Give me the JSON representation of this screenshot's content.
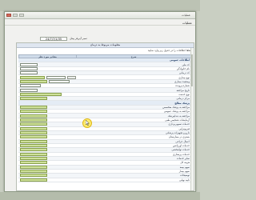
{
  "window": {
    "title": "عملیات",
    "menu": "عملیات"
  },
  "search": {
    "label": "نمبر آپریٹر پینل",
    "date": "24/7/7/1/35"
  },
  "content": {
    "header": "معلومات مربوط به درمان",
    "info_line": "لطفا اطلاعات را در جدول زیر وارد نمایید",
    "col_value": "مقادیر مورد نظر",
    "col_desc": "شرح"
  },
  "rows": [
    {
      "desc": "اطلاعات عمومی",
      "section": true,
      "boxes": []
    },
    {
      "desc": "کد ملی",
      "boxes": [
        {
          "t": "",
          "c": "num"
        }
      ]
    },
    {
      "desc": "نام خانوادگی",
      "boxes": [
        {
          "t": "",
          "c": "num"
        }
      ]
    },
    {
      "desc": "کد درمانی",
      "boxes": [
        {
          "t": "",
          "c": "num"
        }
      ]
    },
    {
      "desc": "نوع بیماری",
      "boxes": [
        {
          "t": "",
          "c": "green"
        },
        {
          "t": "",
          "c": "plain"
        },
        {
          "t": "",
          "c": "btn"
        }
      ]
    },
    {
      "desc": "وضعیت بیماری",
      "boxes": [
        {
          "t": "",
          "c": "green"
        },
        {
          "t": "",
          "c": "plain"
        }
      ]
    },
    {
      "desc": "شماره پرونده",
      "boxes": [
        {
          "t": "",
          "c": "plain"
        }
      ]
    },
    {
      "desc": "تاریخ مراجعه",
      "boxes": [
        {
          "t": "",
          "c": "num"
        }
      ]
    },
    {
      "desc": "نوع خدمت",
      "boxes": [
        {
          "t": "",
          "c": "long"
        }
      ]
    },
    {
      "desc": "مرکز درمانی",
      "boxes": [
        {
          "t": "",
          "c": "green"
        }
      ]
    },
    {
      "desc": "پزشک معالج",
      "section": true,
      "boxes": []
    },
    {
      "desc": "مراجعه به پزشک متخصص",
      "boxes": [
        {
          "t": "",
          "c": "green"
        }
      ]
    },
    {
      "desc": "مراجعه به پزشک عمومی",
      "boxes": [
        {
          "t": "",
          "c": "green"
        }
      ]
    },
    {
      "desc": "مراجعه به دندانپزشک",
      "boxes": [
        {
          "t": "",
          "c": "green"
        }
      ]
    },
    {
      "desc": "آزمایشات تشخیص طبی",
      "boxes": [
        {
          "t": "",
          "c": "green"
        }
      ]
    },
    {
      "desc": "خدمات تصویربرداری",
      "boxes": [
        {
          "t": "",
          "c": "green"
        }
      ]
    },
    {
      "desc": "فیزیوتراپی",
      "boxes": [
        {
          "t": "",
          "c": "green"
        }
      ]
    },
    {
      "desc": "دارو و تجهیزات پزشکی",
      "boxes": [
        {
          "t": "",
          "c": "green"
        }
      ]
    },
    {
      "desc": "بستری در بیمارستان",
      "boxes": [
        {
          "t": "",
          "c": "green"
        }
      ]
    },
    {
      "desc": "اعمال جراحی",
      "boxes": [
        {
          "t": "",
          "c": "green"
        }
      ]
    },
    {
      "desc": "خدمات اورژانس",
      "boxes": [
        {
          "t": "",
          "c": "green"
        }
      ]
    },
    {
      "desc": "خدمات توانبخشی",
      "boxes": [
        {
          "t": "",
          "c": "green"
        }
      ]
    },
    {
      "desc": "خدمات پرستاری",
      "boxes": [
        {
          "t": "",
          "c": "green"
        }
      ]
    },
    {
      "desc": "سایر خدمات",
      "boxes": [
        {
          "t": "",
          "c": "green"
        }
      ]
    },
    {
      "desc": "هزینه کل",
      "boxes": [
        {
          "t": "",
          "c": "green"
        }
      ]
    },
    {
      "desc": "سهم بیمه",
      "boxes": [
        {
          "t": "",
          "c": "green"
        }
      ]
    },
    {
      "desc": "سهم بیمار",
      "boxes": [
        {
          "t": "",
          "c": "green"
        }
      ]
    },
    {
      "desc": "توضیحات",
      "boxes": [
        {
          "t": "",
          "c": "green"
        }
      ]
    },
    {
      "desc": "تایید نهایی",
      "boxes": [
        {
          "t": "",
          "c": "green"
        }
      ]
    }
  ]
}
